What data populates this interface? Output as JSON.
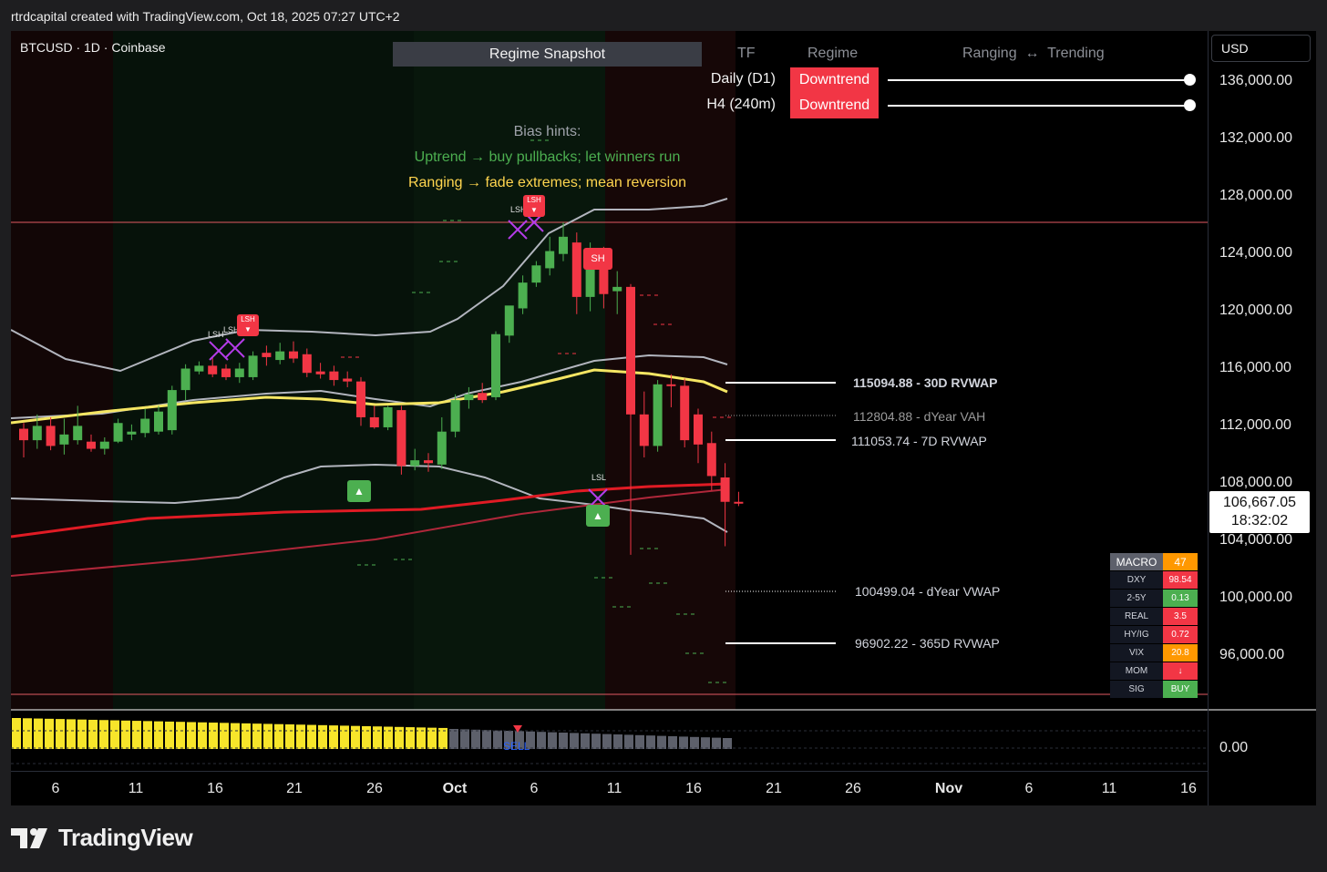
{
  "caption": "rtrdcapital created with TradingView.com, Oct 18, 2025 07:27 UTC+2",
  "symbol": {
    "title": "BTCUSD · 1D · Coinbase"
  },
  "regime": {
    "header": "Regime Snapshot",
    "col_tf": "TF",
    "col_regime": "Regime",
    "col_scale": "Ranging  ↔  Trending",
    "rows": [
      {
        "tf": "Daily (D1)",
        "regime": "Downtrend"
      },
      {
        "tf": "H4 (240m)",
        "regime": "Downtrend"
      }
    ],
    "bias_title": "Bias hints:",
    "bias_up": "Uptrend → buy pullbacks; let winners run",
    "bias_range": "Ranging → fade extremes; mean reversion"
  },
  "price_axis": {
    "currency_button": "USD",
    "ticks": [
      "136,000.00",
      "132,000.00",
      "128,000.00",
      "124,000.00",
      "120,000.00",
      "116,000.00",
      "112,000.00",
      "108,000.00",
      "104,000.00",
      "100,000.00",
      "96,000.00"
    ],
    "last_price": "106,667.05",
    "countdown": "18:32:02",
    "osc_zero": "0.00"
  },
  "date_axis": {
    "ticks": [
      "6",
      "11",
      "16",
      "21",
      "26",
      "Oct",
      "6",
      "11",
      "16",
      "21",
      "26",
      "Nov",
      "6",
      "11",
      "16"
    ],
    "bold": [
      "Oct",
      "Nov"
    ]
  },
  "levels": [
    {
      "label": "115094.88 - 30D RVWAP",
      "color": "#ffffff",
      "style": "solid"
    },
    {
      "label": "112804.88 - dYear VAH",
      "color": "#9a9a9a",
      "style": "dotted"
    },
    {
      "label": "111053.74 - 7D RVWAP",
      "color": "#ffffff",
      "style": "solid"
    },
    {
      "label": "100499.04 - dYear VWAP",
      "color": "#ffffff",
      "style": "dotted"
    },
    {
      "label": "96902.22 - 365D RVWAP",
      "color": "#ffffff",
      "style": "solid"
    }
  ],
  "pivots": {
    "lsh": "LSH",
    "sh": "SH",
    "lsl": "LSL",
    "up": "▲",
    "down": "▼"
  },
  "macro": {
    "title": "MACRO",
    "score": "47",
    "score_color": "#ff9800",
    "rows": [
      {
        "k": "DXY",
        "v": "98.54",
        "color": "#f23645"
      },
      {
        "k": "2-5Y",
        "v": "0.13",
        "color": "#4caf50"
      },
      {
        "k": "REAL",
        "v": "3.5",
        "color": "#f23645"
      },
      {
        "k": "HY/IG",
        "v": "0.72",
        "color": "#f23645"
      },
      {
        "k": "VIX",
        "v": "20.8",
        "color": "#ff9800"
      },
      {
        "k": "MOM",
        "v": "↓",
        "color": "#f23645"
      },
      {
        "k": "SIG",
        "v": "BUY",
        "color": "#4caf50"
      }
    ]
  },
  "oscillator": {
    "signal": "SELL"
  },
  "chart_data": {
    "type": "candlestick",
    "ylim": [
      92000,
      138000
    ],
    "candles": [
      {
        "o": 111800,
        "h": 112200,
        "l": 109800,
        "c": 111000
      },
      {
        "o": 111000,
        "h": 112800,
        "l": 110400,
        "c": 112000
      },
      {
        "o": 112000,
        "h": 112600,
        "l": 110300,
        "c": 110600
      },
      {
        "o": 110700,
        "h": 112500,
        "l": 110000,
        "c": 111400
      },
      {
        "o": 111000,
        "h": 113400,
        "l": 110700,
        "c": 112000
      },
      {
        "o": 110900,
        "h": 111400,
        "l": 110200,
        "c": 110400
      },
      {
        "o": 110400,
        "h": 111200,
        "l": 110000,
        "c": 110900
      },
      {
        "o": 110900,
        "h": 112500,
        "l": 110800,
        "c": 112200
      },
      {
        "o": 111400,
        "h": 112100,
        "l": 111000,
        "c": 111600
      },
      {
        "o": 111500,
        "h": 113200,
        "l": 111200,
        "c": 112500
      },
      {
        "o": 111600,
        "h": 113400,
        "l": 111400,
        "c": 113000
      },
      {
        "o": 111700,
        "h": 114800,
        "l": 111400,
        "c": 114500
      },
      {
        "o": 114500,
        "h": 116300,
        "l": 113800,
        "c": 116000
      },
      {
        "o": 115800,
        "h": 116500,
        "l": 115600,
        "c": 116200
      },
      {
        "o": 116200,
        "h": 116800,
        "l": 115400,
        "c": 115600
      },
      {
        "o": 116000,
        "h": 116300,
        "l": 115200,
        "c": 115400
      },
      {
        "o": 115400,
        "h": 116400,
        "l": 115000,
        "c": 116000
      },
      {
        "o": 115400,
        "h": 117200,
        "l": 115200,
        "c": 116900
      },
      {
        "o": 117100,
        "h": 117600,
        "l": 116200,
        "c": 116800
      },
      {
        "o": 116600,
        "h": 117800,
        "l": 116300,
        "c": 117200
      },
      {
        "o": 117200,
        "h": 117900,
        "l": 116400,
        "c": 116700
      },
      {
        "o": 117000,
        "h": 117400,
        "l": 115400,
        "c": 115700
      },
      {
        "o": 115800,
        "h": 116400,
        "l": 115300,
        "c": 115600
      },
      {
        "o": 115800,
        "h": 116200,
        "l": 114800,
        "c": 115200
      },
      {
        "o": 115300,
        "h": 115800,
        "l": 114700,
        "c": 115100
      },
      {
        "o": 115100,
        "h": 115400,
        "l": 112000,
        "c": 112600
      },
      {
        "o": 112600,
        "h": 113400,
        "l": 111800,
        "c": 111900
      },
      {
        "o": 111900,
        "h": 113400,
        "l": 111700,
        "c": 113300
      },
      {
        "o": 113100,
        "h": 113400,
        "l": 108600,
        "c": 109200
      },
      {
        "o": 109200,
        "h": 110400,
        "l": 108900,
        "c": 109600
      },
      {
        "o": 109600,
        "h": 110100,
        "l": 108800,
        "c": 109400
      },
      {
        "o": 109300,
        "h": 112600,
        "l": 109000,
        "c": 111600
      },
      {
        "o": 111600,
        "h": 114200,
        "l": 111200,
        "c": 113800
      },
      {
        "o": 113800,
        "h": 114700,
        "l": 113200,
        "c": 114200
      },
      {
        "o": 114300,
        "h": 115000,
        "l": 113600,
        "c": 113800
      },
      {
        "o": 114000,
        "h": 118600,
        "l": 113800,
        "c": 118400
      },
      {
        "o": 118300,
        "h": 120300,
        "l": 117800,
        "c": 120400
      },
      {
        "o": 120200,
        "h": 122500,
        "l": 119800,
        "c": 122000
      },
      {
        "o": 122000,
        "h": 123500,
        "l": 121700,
        "c": 123200
      },
      {
        "o": 123000,
        "h": 125200,
        "l": 122500,
        "c": 124200
      },
      {
        "o": 124000,
        "h": 126200,
        "l": 123500,
        "c": 125200
      },
      {
        "o": 124800,
        "h": 125500,
        "l": 119800,
        "c": 121000
      },
      {
        "o": 121000,
        "h": 124800,
        "l": 120000,
        "c": 123200
      },
      {
        "o": 123500,
        "h": 124500,
        "l": 120200,
        "c": 121200
      },
      {
        "o": 121400,
        "h": 122800,
        "l": 119800,
        "c": 121700
      },
      {
        "o": 121700,
        "h": 121900,
        "l": 103000,
        "c": 112800
      },
      {
        "o": 112800,
        "h": 114400,
        "l": 109800,
        "c": 110600
      },
      {
        "o": 110600,
        "h": 115200,
        "l": 110200,
        "c": 114900
      },
      {
        "o": 114900,
        "h": 115600,
        "l": 113300,
        "c": 114800
      },
      {
        "o": 114800,
        "h": 115300,
        "l": 110500,
        "c": 111000
      },
      {
        "o": 112800,
        "h": 113200,
        "l": 109400,
        "c": 110700
      },
      {
        "o": 110800,
        "h": 111600,
        "l": 107500,
        "c": 108500
      },
      {
        "o": 108400,
        "h": 109400,
        "l": 103600,
        "c": 106700
      },
      {
        "o": 106700,
        "h": 107400,
        "l": 106400,
        "c": 106667
      }
    ]
  }
}
